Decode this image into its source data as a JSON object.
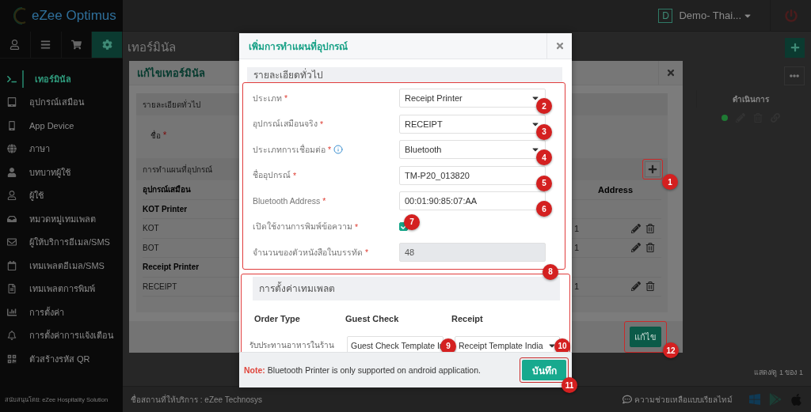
{
  "sidebar": {
    "brand": "eZee Optimus",
    "nav_tabs": [
      {
        "kind": "user",
        "selected": false
      },
      {
        "kind": "menu",
        "selected": false
      },
      {
        "kind": "cart",
        "selected": false
      },
      {
        "kind": "settings",
        "selected": true
      }
    ],
    "items": [
      {
        "label": "เทอร์มินัล",
        "kind": "terminal",
        "selected": true
      },
      {
        "label": "อุปกรณ์เสมือน",
        "kind": "tablet",
        "selected": false
      },
      {
        "label": "App Device",
        "kind": "phone",
        "selected": false
      },
      {
        "label": "ภาษา",
        "kind": "language",
        "selected": false
      },
      {
        "label": "บทบาทผู้ใช้",
        "kind": "role",
        "selected": false
      },
      {
        "label": "ผู้ใช้",
        "kind": "user",
        "selected": false
      },
      {
        "label": "หมวดหมู่เทมเพลต",
        "kind": "inbox",
        "selected": false
      },
      {
        "label": "ผู้ให้บริการอีเมล/SMS",
        "kind": "mail",
        "selected": false
      },
      {
        "label": "เทมเพลตอีเมล/SMS",
        "kind": "calendar",
        "selected": false
      },
      {
        "label": "เทมเพลตการพิมพ์",
        "kind": "document",
        "selected": false
      },
      {
        "label": "การตั้งค่า",
        "kind": "chart",
        "selected": false
      },
      {
        "label": "การตั้งค่าการแจ้งเตือน",
        "kind": "bell",
        "selected": false
      },
      {
        "label": "ตัวสร้างรหัส QR",
        "kind": "qr",
        "selected": false
      }
    ],
    "footer": "สนับสนุนโดย: eZee Hospitality Solution"
  },
  "header": {
    "account_initial": "D",
    "account_name": "Demo- Thai..."
  },
  "page": {
    "title": "เทอร์มินัล",
    "column": "ดำเนินการ",
    "rows": [
      {
        "color": "#1f7a34"
      }
    ],
    "pagination": "แสดง/ดู 1 ของ 1"
  },
  "footer": {
    "location": "ชื่อสถานที่ให้บริการ : eZee Technosys",
    "help": "ความช่วยเหลือแบบเรียลไทม์"
  },
  "edit_dialog": {
    "title": "แก้ไขเทอร์มินัล",
    "general_section": "รายละเอียดทั่วไป",
    "name_label": "ชื่อ",
    "name_mark": "*",
    "mapping_section": "การทำแผนที่อุปกรณ์",
    "add_badge": "1",
    "columns": [
      "อุปกรณ์เสมือน",
      "Address"
    ],
    "rows": [
      {
        "kind": "group",
        "name": "KOT Printer"
      },
      {
        "kind": "device",
        "name": "KOT",
        "address": "1"
      },
      {
        "kind": "device",
        "name": "BOT",
        "address": "1"
      },
      {
        "kind": "group",
        "name": "Receipt Printer"
      },
      {
        "kind": "device",
        "name": "RECEIPT",
        "address": "1"
      }
    ],
    "button": "แก้ไข",
    "button_badge": "12"
  },
  "mapping_dialog": {
    "title": "เพิ่มการทำแผนที่อุปกรณ์",
    "general_section": "รายละเอียดทั่วไป",
    "general_badge": "8",
    "fields": [
      {
        "kind": "select",
        "label": "ประเภท",
        "mark": "*",
        "info": false,
        "value": "Receipt Printer",
        "disabled": false,
        "badge": "2"
      },
      {
        "kind": "select",
        "label": "อุปกรณ์เสมือนจริง",
        "mark": "*",
        "info": false,
        "value": "RECEIPT",
        "disabled": false,
        "badge": "3"
      },
      {
        "kind": "select",
        "label": "ประเภทการเชื่อมต่อ",
        "mark": "*",
        "info": true,
        "value": "Bluetooth",
        "disabled": false,
        "badge": "4"
      },
      {
        "kind": "text",
        "label": "ชื่ออุปกรณ์",
        "mark": "*",
        "info": false,
        "value": "TM-P20_013820",
        "disabled": false,
        "badge": "5"
      },
      {
        "kind": "text",
        "label": "Bluetooth Address",
        "mark": "*",
        "info": false,
        "value": "00:01:90:85:07:AA",
        "disabled": false,
        "badge": "6"
      },
      {
        "kind": "checkbox",
        "label": "เปิดใช้งานการพิมพ์ข้อความ",
        "mark": "*",
        "info": false,
        "checked": true,
        "badge": "7"
      },
      {
        "kind": "text",
        "label": "จำนวนของตัวหนังสือในบรรทัด",
        "mark": "*",
        "info": false,
        "value": "48",
        "disabled": true
      }
    ],
    "template_section": "การตั้งค่าเทมเพลต",
    "template_columns": [
      "Order Type",
      "Guest Check",
      "Receipt"
    ],
    "template_rows": [
      {
        "order_type": "รับประทานอาหารในร้าน",
        "guest_check": "Guest Check Template Ir",
        "guest_check_badge": "9",
        "receipt": "Receipt Template India",
        "receipt_badge": "10"
      }
    ],
    "note_label": "Note:",
    "note": "Bluetooth Printer is only supported on android application.",
    "button": "บันทึก",
    "button_badge": "11"
  }
}
